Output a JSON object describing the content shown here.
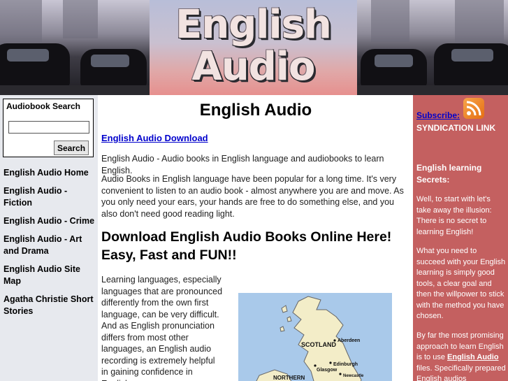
{
  "header": {
    "logo_line_1": "English",
    "logo_line_2": "Audio"
  },
  "search": {
    "title": "Audiobook Search",
    "input_value": "",
    "button_label": "Search"
  },
  "nav": {
    "items": [
      "English Audio Home",
      "English Audio - Fiction",
      "English Audio - Crime",
      "English Audio - Art and Drama",
      "English Audio Site Map",
      "Agatha Christie Short Stories"
    ]
  },
  "main": {
    "title": "English Audio",
    "download_link": "English Audio Download",
    "intro": "English Audio - Audio books in English language and audiobooks to learn English.",
    "paragraph_2": "Audio Books in English language have been popular for a long time. It's very convenient to listen to an audio book - almost anywhere you are and move. As you only need your ears, your hands are free to do something else, and you also don't need good reading light.",
    "headline": "Download English Audio Books Online Here! Easy, Fast and FUN!!",
    "learning_paragraph": "Learning languages, especially languages that are pronounced differently from the own first language, can be very difficult. And as English pronunciation differs from most other languages, an English audio recording is extremely helpful in gaining confidence in English",
    "map": {
      "labels": [
        "SCOTLAND",
        "Aberdeen",
        "Glasgow",
        "Edinburgh",
        "Newcastle",
        "NORTHERN"
      ],
      "colors": {
        "sea": "#a9c9ea",
        "land": "#f3edc8"
      }
    }
  },
  "right": {
    "subscribe_label": "Subscribe:",
    "rss_icon": "rss-icon",
    "syndication_label": "SYNDICATION LINK",
    "secrets_title": "English learning Secrets:",
    "para_1": "Well, to start with let's take away the illusion: There is no secret to learning English!",
    "para_2": "What you need to succeed with your English learning is simply good tools, a clear goal and then the willpower to stick with the method you have chosen.",
    "para_3_before": "By far the most promising approach to learn English is to use ",
    "para_3_link": "English Audio",
    "para_3_after": " files. Specifically prepared English audios"
  },
  "colors": {
    "left_sidebar_bg": "#e7e9ee",
    "right_sidebar_bg": "#c46060",
    "link_blue": "#0000cc"
  }
}
